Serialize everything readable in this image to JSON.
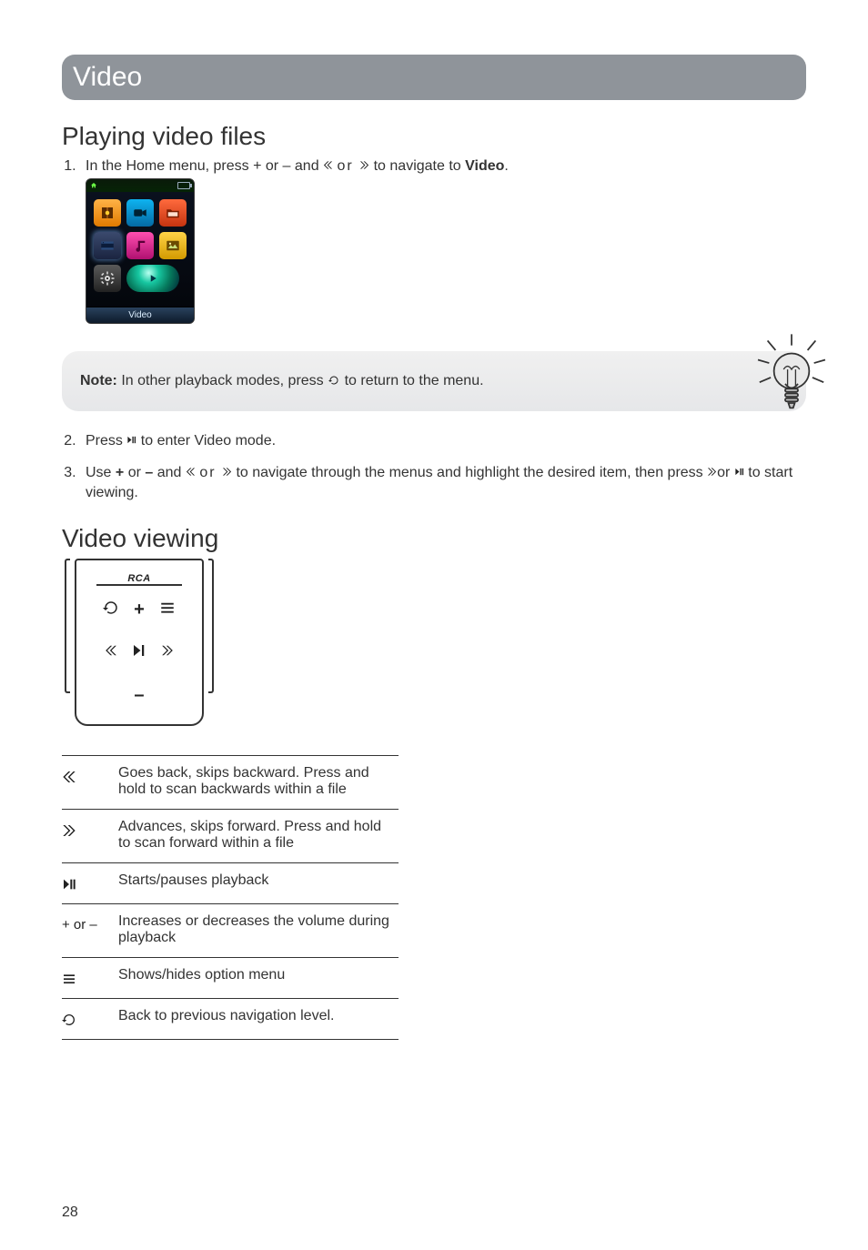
{
  "titlebar": {
    "title": "Video"
  },
  "section1": {
    "heading": "Playing video files",
    "step1_pre": "In the Home menu, press + or – and ",
    "step1_mid": " or ",
    "step1_post": " to navigate to ",
    "step1_bold": "Video",
    "step1_end": ".",
    "home_caption": "Video"
  },
  "note": {
    "label": "Note:",
    "text_pre": " In other playback modes, press ",
    "text_post": " to return to the menu."
  },
  "steps": {
    "s2_pre": "Press ",
    "s2_post": " to enter Video mode.",
    "s3_pre": "Use ",
    "s3_plus": "+",
    "s3_or1": " or ",
    "s3_minus": "–",
    "s3_and": " and ",
    "s3_or2": " or ",
    "s3_mid": " to navigate through the menus and highlight the desired item, then press ",
    "s3_or3": "or ",
    "s3_post": " to start viewing."
  },
  "section2": {
    "heading": "Video viewing",
    "device_logo": "RCA"
  },
  "controls": [
    {
      "key": "prev",
      "desc": "Goes back, skips backward. Press and hold to scan backwards within a file"
    },
    {
      "key": "next",
      "desc": "Advances, skips forward. Press and hold to scan forward within a file"
    },
    {
      "key": "play",
      "desc": "Starts/pauses playback"
    },
    {
      "key": "vol",
      "label": "+ or –",
      "desc": "Increases or decreases the volume during playback"
    },
    {
      "key": "menu",
      "desc": "Shows/hides option menu"
    },
    {
      "key": "back",
      "desc": "Back to previous navigation level."
    }
  ],
  "page_number": "28"
}
